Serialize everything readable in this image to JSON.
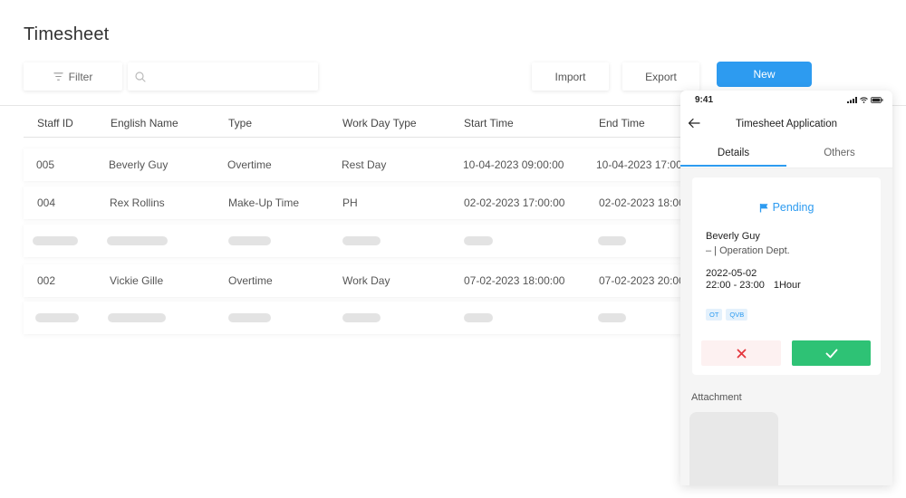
{
  "page": {
    "title": "Timesheet"
  },
  "toolbar": {
    "filter_label": "Filter",
    "search_placeholder": "",
    "import_label": "Import",
    "export_label": "Export",
    "new_label": "New"
  },
  "table": {
    "columns": [
      "Staff ID",
      "English Name",
      "Type",
      "Work Day Type",
      "Start Time",
      "End Time"
    ],
    "rows": [
      {
        "staff_id": "005",
        "name": "Beverly Guy",
        "type": "Overtime",
        "work_day_type": "Rest Day",
        "start_time": "10-04-2023  09:00:00",
        "end_time": "10-04-2023 17:00"
      },
      {
        "staff_id": "004",
        "name": "Rex Rollins",
        "type": "Make-Up Time",
        "work_day_type": "PH",
        "start_time": "02-02-2023 17:00:00",
        "end_time": "02-02-2023 18:00"
      },
      {
        "staff_id": "002",
        "name": "Vickie Gille",
        "type": "Overtime",
        "work_day_type": "Work Day",
        "start_time": "07-02-2023 18:00:00",
        "end_time": "07-02-2023 20:00"
      }
    ]
  },
  "mobile": {
    "status_time": "9:41",
    "nav_title": "Timesheet Application",
    "tabs": [
      "Details",
      "Others"
    ],
    "status_text": "Pending",
    "applicant": "Beverly Guy",
    "department": "–  |  Operation Dept.",
    "date": "2022-05-02",
    "time_range": "22:00 - 23:00",
    "duration": "1Hour",
    "tags": [
      "OT",
      "QVB"
    ],
    "attachment_label": "Attachment"
  },
  "colors": {
    "primary": "#2d9bf0",
    "approve": "#2ec275",
    "reject": "#e5373e",
    "skeleton": "#e3e3e3"
  }
}
